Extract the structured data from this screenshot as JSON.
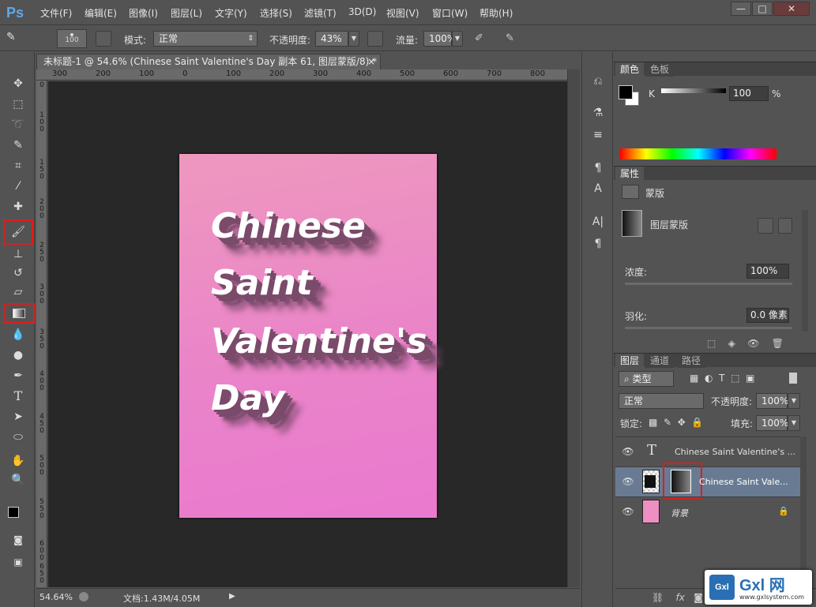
{
  "app": {
    "logo": "Ps"
  },
  "menubar": {
    "items": [
      "文件(F)",
      "编辑(E)",
      "图像(I)",
      "图层(L)",
      "文字(Y)",
      "选择(S)",
      "滤镜(T)",
      "3D(D)",
      "视图(V)",
      "窗口(W)",
      "帮助(H)"
    ]
  },
  "window_controls": {
    "minimize": "—",
    "maximize": "□",
    "close": "✕"
  },
  "options": {
    "brush_size": "100",
    "mode_label": "模式:",
    "mode_value": "正常",
    "opacity_label": "不透明度:",
    "opacity_value": "43%",
    "flow_label": "流量:",
    "flow_value": "100%"
  },
  "document": {
    "tab_title": "未标题-1 @ 54.6% (Chinese  Saint  Valentine's  Day 副本 61, 图层蒙版/8) *",
    "close": "×",
    "ruler_h": [
      "300",
      "200",
      "100",
      "0",
      "100",
      "200",
      "300",
      "400",
      "500",
      "600",
      "700",
      "800"
    ],
    "ruler_v": [
      "0",
      "1 0 0",
      "1 5 0",
      "2 0 0",
      "2 5 0",
      "3 0 0",
      "3 5 0",
      "4 0 0",
      "4 5 0",
      "5 0 0",
      "5 5 0",
      "6 0 0",
      "6 5 0"
    ],
    "artwork_lines": [
      "Chinese",
      "Saint",
      "Valentine's",
      "Day"
    ],
    "colors": {
      "bg_top": "#ee98be",
      "bg_bottom": "#ea79cf",
      "text": "#ffffff",
      "shadow": "#7a4a6a"
    }
  },
  "status": {
    "zoom": "54.64%",
    "doc_info": "文档:1.43M/4.05M"
  },
  "color_panel": {
    "tabs": [
      "颜色",
      "色板"
    ],
    "channel_label": "K",
    "channel_value": "100",
    "unit": "%"
  },
  "properties_panel": {
    "tab": "属性",
    "mask_type_label": "蒙版",
    "layer_mask_label": "图层蒙版",
    "density_label": "浓度:",
    "density_value": "100%",
    "feather_label": "羽化:",
    "feather_value": "0.0 像素"
  },
  "layers_panel": {
    "tabs": [
      "图层",
      "通道",
      "路径"
    ],
    "filter_label": "类型",
    "blend_mode": "正常",
    "opacity_label": "不透明度:",
    "opacity_value": "100%",
    "lock_label": "锁定:",
    "fill_label": "填充:",
    "fill_value": "100%",
    "layers": [
      {
        "name": "Chinese Saint Valentine's ...",
        "kind": "text"
      },
      {
        "name": "Chinese  Saint  Vale...",
        "kind": "masked"
      },
      {
        "name": "背景",
        "kind": "background"
      }
    ]
  },
  "watermark": {
    "logo_text": "Gxl",
    "brand": "Gxl 网",
    "url": "www.gxlsystem.com"
  }
}
